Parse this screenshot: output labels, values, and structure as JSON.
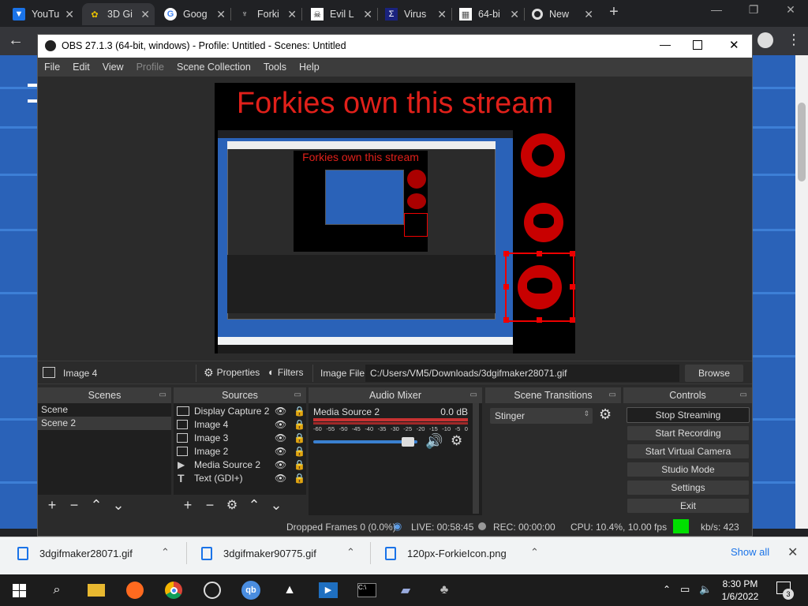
{
  "browser": {
    "tabs": [
      {
        "title": "YouTu",
        "icon": "youtube-icon",
        "active": false
      },
      {
        "title": "3D Gi",
        "icon": "3d-gif-icon",
        "active": true
      },
      {
        "title": "Goog",
        "icon": "google-icon",
        "active": false
      },
      {
        "title": "Forki",
        "icon": "forkie-icon",
        "active": false
      },
      {
        "title": "Evil L",
        "icon": "evil-icon",
        "active": false
      },
      {
        "title": "Virus",
        "icon": "sigma-icon",
        "active": false
      },
      {
        "title": "64-bi",
        "icon": "image-icon",
        "active": false
      },
      {
        "title": "New",
        "icon": "chrome-icon",
        "active": false
      }
    ],
    "new_tab_label": "+"
  },
  "obs": {
    "title": "OBS 27.1.3 (64-bit, windows) - Profile: Untitled - Scenes: Untitled",
    "menu": [
      "File",
      "Edit",
      "View",
      "Profile",
      "Scene Collection",
      "Tools",
      "Help"
    ],
    "preview_text": "Forkies own this stream",
    "nested_preview_text": "Forkies own this stream",
    "context_bar": {
      "source_name": "Image 4",
      "properties_label": "Properties",
      "filters_label": "Filters",
      "image_file_label": "Image File",
      "image_file_value": "C:/Users/VM5/Downloads/3dgifmaker28071.gif",
      "browse_label": "Browse"
    },
    "scenes": {
      "title": "Scenes",
      "items": [
        {
          "name": "Scene",
          "selected": false
        },
        {
          "name": "Scene 2",
          "selected": true
        }
      ]
    },
    "sources": {
      "title": "Sources",
      "items": [
        {
          "name": "Display Capture 2",
          "icon": "monitor-icon"
        },
        {
          "name": "Image 4",
          "icon": "image-icon"
        },
        {
          "name": "Image 3",
          "icon": "image-icon"
        },
        {
          "name": "Image 2",
          "icon": "image-icon"
        },
        {
          "name": "Media Source 2",
          "icon": "play-icon"
        },
        {
          "name": "Text (GDI+)",
          "icon": "text-icon"
        }
      ]
    },
    "audio_mixer": {
      "title": "Audio Mixer",
      "source": "Media Source 2",
      "level": "0.0 dB",
      "ticks": [
        "-60",
        "-55",
        "-50",
        "-45",
        "-40",
        "-35",
        "-30",
        "-25",
        "-20",
        "-15",
        "-10",
        "-5",
        "0"
      ],
      "volume_fraction": 0.97
    },
    "transitions": {
      "title": "Scene Transitions",
      "selected": "Stinger"
    },
    "controls": {
      "title": "Controls",
      "buttons": [
        "Stop Streaming",
        "Start Recording",
        "Start Virtual Camera",
        "Studio Mode",
        "Settings",
        "Exit"
      ]
    },
    "status": {
      "dropped": "Dropped Frames 0 (0.0%)",
      "live": "LIVE: 00:58:45",
      "rec": "REC: 00:00:00",
      "cpu": "CPU: 10.4%, 10.00 fps",
      "kbs": "kb/s: 423"
    },
    "colors": {
      "accent_red": "#c80000",
      "title_red": "#e0201a",
      "status_green": "#00e000"
    }
  },
  "downloads": {
    "items": [
      "3dgifmaker28071.gif",
      "3dgifmaker90775.gif",
      "120px-ForkieIcon.png"
    ],
    "show_all": "Show all"
  },
  "taskbar": {
    "time": "8:30 PM",
    "date": "1/6/2022",
    "notifications": "3"
  }
}
